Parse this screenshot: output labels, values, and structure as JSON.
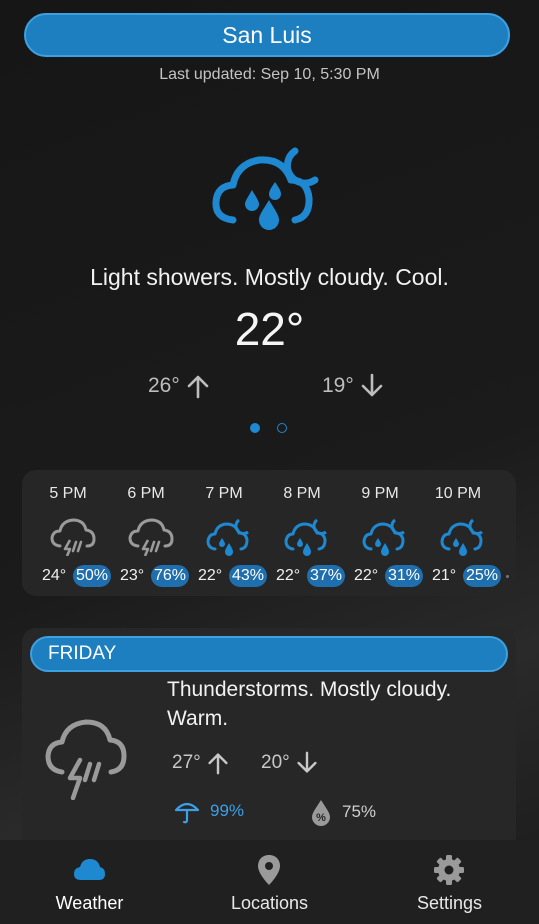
{
  "header": {
    "city": "San Luis",
    "last_updated": "Last updated: Sep 10, 5:30 PM"
  },
  "current": {
    "icon": "rain-cloud-moon-icon",
    "condition": "Light showers. Mostly cloudy. Cool.",
    "temperature": "22°",
    "high": "26°",
    "low": "19°",
    "page_indicator": {
      "count": 2,
      "active": 1
    }
  },
  "hourly": [
    {
      "time": "5 PM",
      "icon": "thunderstorm-icon",
      "temp": "24°",
      "pop": "50%"
    },
    {
      "time": "6 PM",
      "icon": "thunderstorm-icon",
      "temp": "23°",
      "pop": "76%"
    },
    {
      "time": "7 PM",
      "icon": "rain-cloud-moon-icon",
      "temp": "22°",
      "pop": "43%"
    },
    {
      "time": "8 PM",
      "icon": "rain-cloud-moon-icon",
      "temp": "22°",
      "pop": "37%"
    },
    {
      "time": "9 PM",
      "icon": "rain-cloud-moon-icon",
      "temp": "22°",
      "pop": "31%"
    },
    {
      "time": "10 PM",
      "icon": "rain-cloud-moon-icon",
      "temp": "21°",
      "pop": "25%"
    }
  ],
  "daily": [
    {
      "day": "FRIDAY",
      "icon": "thunderstorm-icon",
      "condition": "Thunderstorms. Mostly cloudy. Warm.",
      "high": "27°",
      "low": "20°",
      "rain_chance": "99%",
      "humidity": "75%"
    }
  ],
  "nav": [
    {
      "label": "Weather",
      "icon": "cloud-icon",
      "active": true
    },
    {
      "label": "Locations",
      "icon": "location-pin-icon",
      "active": false
    },
    {
      "label": "Settings",
      "icon": "gear-icon",
      "active": false
    }
  ],
  "colors": {
    "accent": "#1d7ec0",
    "icon_blue": "#1e88d0",
    "icon_gray": "#9a9a9a",
    "background": "#1b1b1b",
    "card": "#262626"
  }
}
